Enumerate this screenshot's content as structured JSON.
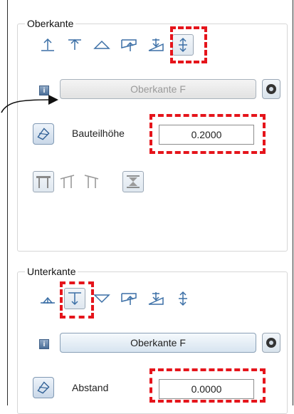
{
  "colors": {
    "highlight": "#e5141b",
    "icon_blue": "#3b6fa6"
  },
  "oberkante": {
    "title": "Oberkante",
    "icons": [
      "arrow-up-line-icon",
      "arrow-down-line-icon",
      "triangle-icon",
      "slope-arrow-icon",
      "stair-slope-icon",
      "double-arrow-icon"
    ],
    "reference_button": "Oberkante F",
    "height_label": "Bauteilhöhe",
    "height_value": "0.2000",
    "shape_icons": [
      "roof-flat-icon",
      "roof-left-icon",
      "roof-right-icon",
      "hourglass-icon"
    ]
  },
  "unterkante": {
    "title": "Unterkante",
    "icons": [
      "arrow-up-line-icon",
      "arrow-down-line-icon",
      "triangle-down-icon",
      "slope-arrow-icon",
      "stair-slope-icon",
      "double-arrow-icon"
    ],
    "reference_button": "Oberkante F",
    "distance_label": "Abstand",
    "distance_value": "0.0000"
  }
}
